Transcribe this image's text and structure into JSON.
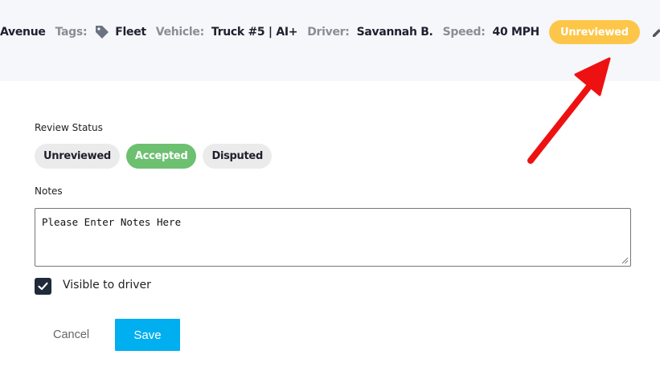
{
  "header": {
    "address_tail": "Avenue",
    "tags_label": "Tags:",
    "tag_value": "Fleet",
    "vehicle_label": "Vehicle:",
    "vehicle_value": "Truck #5 | AI+",
    "driver_label": "Driver:",
    "driver_value": "Savannah B.",
    "speed_label": "Speed:",
    "speed_value": "40 MPH",
    "status_badge": "Unreviewed",
    "tag_icon": "tag-icon",
    "edit_icon": "pencil-icon"
  },
  "review": {
    "label": "Review Status",
    "options": [
      "Unreviewed",
      "Accepted",
      "Disputed"
    ],
    "selected": "Accepted"
  },
  "notes": {
    "label": "Notes",
    "placeholder": "Please Enter Notes Here",
    "value": ""
  },
  "visibility": {
    "label": "Visible to driver",
    "checked": true
  },
  "actions": {
    "cancel_label": "Cancel",
    "save_label": "Save"
  },
  "colors": {
    "badge_unreviewed": "#fdc649",
    "accepted": "#6cc070",
    "save_button": "#00aff0",
    "annotation_arrow": "#ee1111"
  }
}
